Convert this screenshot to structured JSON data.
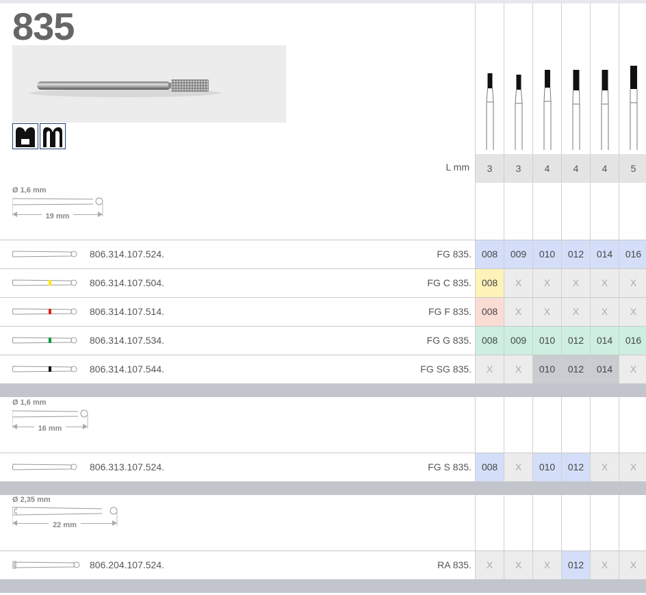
{
  "title": "835",
  "applications": [
    "crown-cavity-icon",
    "tooth-cavity-icon"
  ],
  "sizes": [
    "3",
    "3",
    "4",
    "4",
    "4",
    "5"
  ],
  "lmm_label": "L mm",
  "colors": {
    "blue": "#d4def8",
    "yellow": "#fdf2b8",
    "red": "#fbdcd4",
    "green": "#cdeee0",
    "grey": "#c9ccd1",
    "x": "#ececec",
    "ring_yellow": "#ffe600",
    "ring_red": "#e1251b",
    "ring_green": "#009a44",
    "ring_black": "#111111"
  },
  "sections": [
    {
      "shank_diameter": "Ø 1,6 mm",
      "shank_length": "19 mm",
      "rows": [
        {
          "ref": "806.314.107.524.",
          "code": "FG 835.",
          "ring": "",
          "cells": [
            {
              "v": "008",
              "c": "blue"
            },
            {
              "v": "009",
              "c": "blue"
            },
            {
              "v": "010",
              "c": "blue"
            },
            {
              "v": "012",
              "c": "blue"
            },
            {
              "v": "014",
              "c": "blue"
            },
            {
              "v": "016",
              "c": "blue"
            }
          ]
        },
        {
          "ref": "806.314.107.504.",
          "code": "FG C 835.",
          "ring": "ring_yellow",
          "cells": [
            {
              "v": "008",
              "c": "yellow"
            },
            {
              "v": "X",
              "c": "x"
            },
            {
              "v": "X",
              "c": "x"
            },
            {
              "v": "X",
              "c": "x"
            },
            {
              "v": "X",
              "c": "x"
            },
            {
              "v": "X",
              "c": "x"
            }
          ]
        },
        {
          "ref": "806.314.107.514.",
          "code": "FG F 835.",
          "ring": "ring_red",
          "cells": [
            {
              "v": "008",
              "c": "red"
            },
            {
              "v": "X",
              "c": "x"
            },
            {
              "v": "X",
              "c": "x"
            },
            {
              "v": "X",
              "c": "x"
            },
            {
              "v": "X",
              "c": "x"
            },
            {
              "v": "X",
              "c": "x"
            }
          ]
        },
        {
          "ref": "806.314.107.534.",
          "code": "FG G 835.",
          "ring": "ring_green",
          "cells": [
            {
              "v": "008",
              "c": "green"
            },
            {
              "v": "009",
              "c": "green"
            },
            {
              "v": "010",
              "c": "green"
            },
            {
              "v": "012",
              "c": "green"
            },
            {
              "v": "014",
              "c": "green"
            },
            {
              "v": "016",
              "c": "green"
            }
          ]
        },
        {
          "ref": "806.314.107.544.",
          "code": "FG SG 835.",
          "ring": "ring_black",
          "cells": [
            {
              "v": "X",
              "c": "x"
            },
            {
              "v": "X",
              "c": "x"
            },
            {
              "v": "010",
              "c": "grey"
            },
            {
              "v": "012",
              "c": "grey"
            },
            {
              "v": "014",
              "c": "grey"
            },
            {
              "v": "X",
              "c": "x"
            }
          ]
        }
      ]
    },
    {
      "shank_diameter": "Ø 1,6 mm",
      "shank_length": "16 mm",
      "rows": [
        {
          "ref": "806.313.107.524.",
          "code": "FG S 835.",
          "ring": "",
          "cells": [
            {
              "v": "008",
              "c": "blue"
            },
            {
              "v": "X",
              "c": "x"
            },
            {
              "v": "010",
              "c": "blue"
            },
            {
              "v": "012",
              "c": "blue"
            },
            {
              "v": "X",
              "c": "x"
            },
            {
              "v": "X",
              "c": "x"
            }
          ]
        }
      ]
    },
    {
      "shank_diameter": "Ø 2,35 mm",
      "shank_length": "22 mm",
      "rows": [
        {
          "ref": "806.204.107.524.",
          "code": "RA 835.",
          "ring": "",
          "cells": [
            {
              "v": "X",
              "c": "x"
            },
            {
              "v": "X",
              "c": "x"
            },
            {
              "v": "X",
              "c": "x"
            },
            {
              "v": "012",
              "c": "blue"
            },
            {
              "v": "X",
              "c": "x"
            },
            {
              "v": "X",
              "c": "x"
            }
          ]
        }
      ]
    }
  ]
}
